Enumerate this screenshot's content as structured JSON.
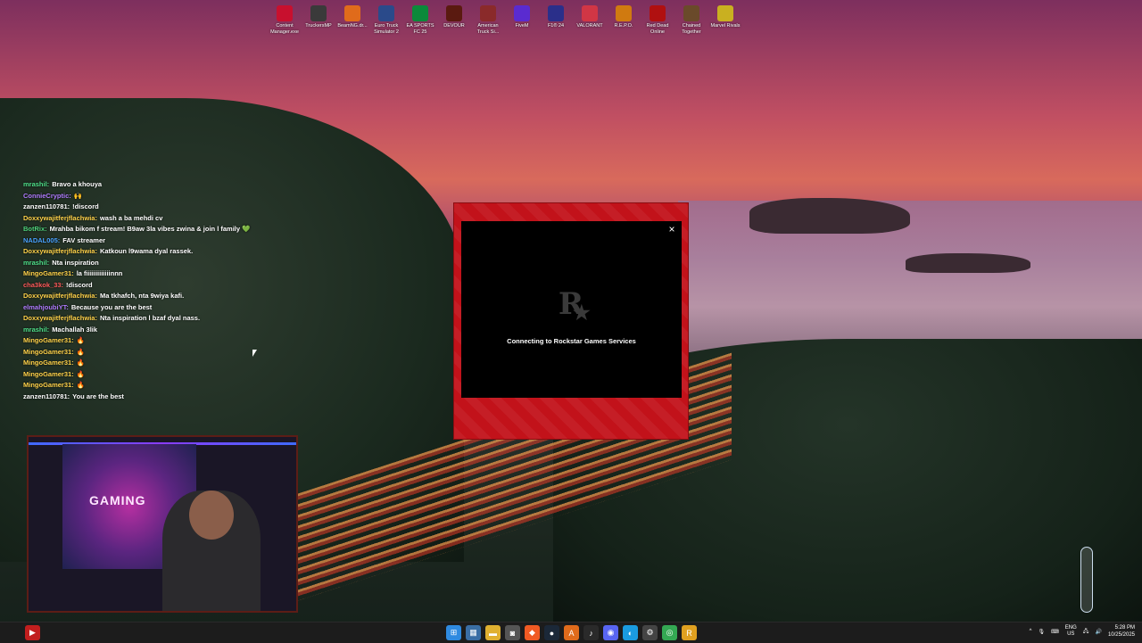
{
  "desktop_icons": [
    {
      "label": "Content Manager.exe",
      "icon": "content-manager-icon",
      "color": "#c8102e"
    },
    {
      "label": "TruckersMP",
      "icon": "truckersmp-icon",
      "color": "#3a3a3a"
    },
    {
      "label": "BeamNG.dr...",
      "icon": "beamng-icon",
      "color": "#e06b1b"
    },
    {
      "label": "Euro Truck Simulator 2",
      "icon": "ets2-icon",
      "color": "#2a4a8a"
    },
    {
      "label": "EA SPORTS FC 25",
      "icon": "eafc-icon",
      "color": "#0b8a3a"
    },
    {
      "label": "DEVOUR",
      "icon": "devour-icon",
      "color": "#5a1a10"
    },
    {
      "label": "American Truck Si...",
      "icon": "ats-icon",
      "color": "#8a2a2a"
    },
    {
      "label": "FiveM",
      "icon": "fivem-icon",
      "color": "#5a2bd0"
    },
    {
      "label": "F1® 24",
      "icon": "f1-icon",
      "color": "#2a2f8a"
    },
    {
      "label": "VALORANT",
      "icon": "valorant-icon",
      "color": "#d13645"
    },
    {
      "label": "R.E.P.O.",
      "icon": "repo-icon",
      "color": "#d07a10"
    },
    {
      "label": "Red Dead Online",
      "icon": "rdo-icon",
      "color": "#b01010"
    },
    {
      "label": "Chained Together",
      "icon": "chained-together-icon",
      "color": "#6a4a2a"
    },
    {
      "label": "Marvel Rivals",
      "icon": "marvel-rivals-icon",
      "color": "#c9b020"
    }
  ],
  "chat": [
    {
      "user": "mrashil:",
      "message": "Bravo a khouya",
      "color": "#4fe08a"
    },
    {
      "user": "ConnieCryptic:",
      "message": "🙌",
      "color": "#b07cff"
    },
    {
      "user": "zanzen110781:",
      "message": "!discord",
      "color": "#ffffff"
    },
    {
      "user": "Doxxywajitferjflachwia:",
      "message": "wash a ba mehdi cv",
      "color": "#ffd24a"
    },
    {
      "user": "BotRix:",
      "message": "Mrahba bikom f stream! B9aw 3la vibes zwina & join l family 💚",
      "color": "#4fd17b"
    },
    {
      "user": "NADAL005:",
      "message": "FAV streamer",
      "color": "#4aa3ff"
    },
    {
      "user": "Doxxywajitferjflachwia:",
      "message": "Katkoun l9wama dyal rassek.",
      "color": "#ffd24a"
    },
    {
      "user": "mrashil:",
      "message": "Nta inspiration",
      "color": "#4fe08a"
    },
    {
      "user": "MingoGamer31:",
      "message": "la fiiiiiiiiiiiiinnn",
      "color": "#ffd24a"
    },
    {
      "user": "cha3kok_33:",
      "message": "!discord",
      "color": "#ff5b5b"
    },
    {
      "user": "Doxxywajitferjflachwia:",
      "message": "Ma tkhafch, nta 9wiya kafi.",
      "color": "#ffd24a"
    },
    {
      "user": "elmahjoubiYT:",
      "message": "Because you are the best",
      "color": "#b07cff"
    },
    {
      "user": "Doxxywajitferjflachwia:",
      "message": "Nta inspiration l bzaf dyal nass.",
      "color": "#ffd24a"
    },
    {
      "user": "mrashil:",
      "message": "Machallah 3lik",
      "color": "#4fe08a"
    },
    {
      "user": "MingoGamer31:",
      "message": "🔥",
      "color": "#ffd24a"
    },
    {
      "user": "MingoGamer31:",
      "message": "🔥",
      "color": "#ffd24a"
    },
    {
      "user": "MingoGamer31:",
      "message": "🔥",
      "color": "#ffd24a"
    },
    {
      "user": "MingoGamer31:",
      "message": "🔥",
      "color": "#ffd24a"
    },
    {
      "user": "MingoGamer31:",
      "message": "🔥",
      "color": "#ffd24a"
    },
    {
      "user": "zanzen110781:",
      "message": "You are the best",
      "color": "#ffffff"
    }
  ],
  "webcam": {
    "poster_text": "GAMING"
  },
  "rockstar_dialog": {
    "close_label": "×",
    "logo_letter": "R",
    "logo_star": "★",
    "status": "Connecting to Rockstar Games Services",
    "frame_color": "#c2121a"
  },
  "taskbar": {
    "left_app": {
      "icon": "youtube-icon",
      "label": "▶"
    },
    "center": [
      {
        "icon": "windows-start-icon",
        "label": "⊞",
        "color": "#2f8ae0"
      },
      {
        "icon": "calendar-icon",
        "label": "▦",
        "color": "#3a6ea5"
      },
      {
        "icon": "file-explorer-icon",
        "label": "▬",
        "color": "#e0b030"
      },
      {
        "icon": "camera-icon",
        "label": "◙",
        "color": "#555555"
      },
      {
        "icon": "brave-icon",
        "label": "◆",
        "color": "#f05a23"
      },
      {
        "icon": "steam-icon",
        "label": "●",
        "color": "#1b2838"
      },
      {
        "icon": "app-a-icon",
        "label": "A",
        "color": "#e06b1b"
      },
      {
        "icon": "tiktok-icon",
        "label": "♪",
        "color": "#2a2a2a"
      },
      {
        "icon": "discord-icon",
        "label": "◉",
        "color": "#5865f2"
      },
      {
        "icon": "edge-icon",
        "label": "◐",
        "color": "#1a9be0"
      },
      {
        "icon": "settings-icon",
        "label": "⚙",
        "color": "#444444"
      },
      {
        "icon": "chrome-icon",
        "label": "◎",
        "color": "#34a853"
      },
      {
        "icon": "rockstar-launcher-icon",
        "label": "R",
        "color": "#e0a020"
      }
    ],
    "tray": {
      "chevron": "^",
      "lang_top": "ENG",
      "lang_bottom": "US",
      "time": "5:28 PM",
      "date": "10/25/2025"
    }
  }
}
